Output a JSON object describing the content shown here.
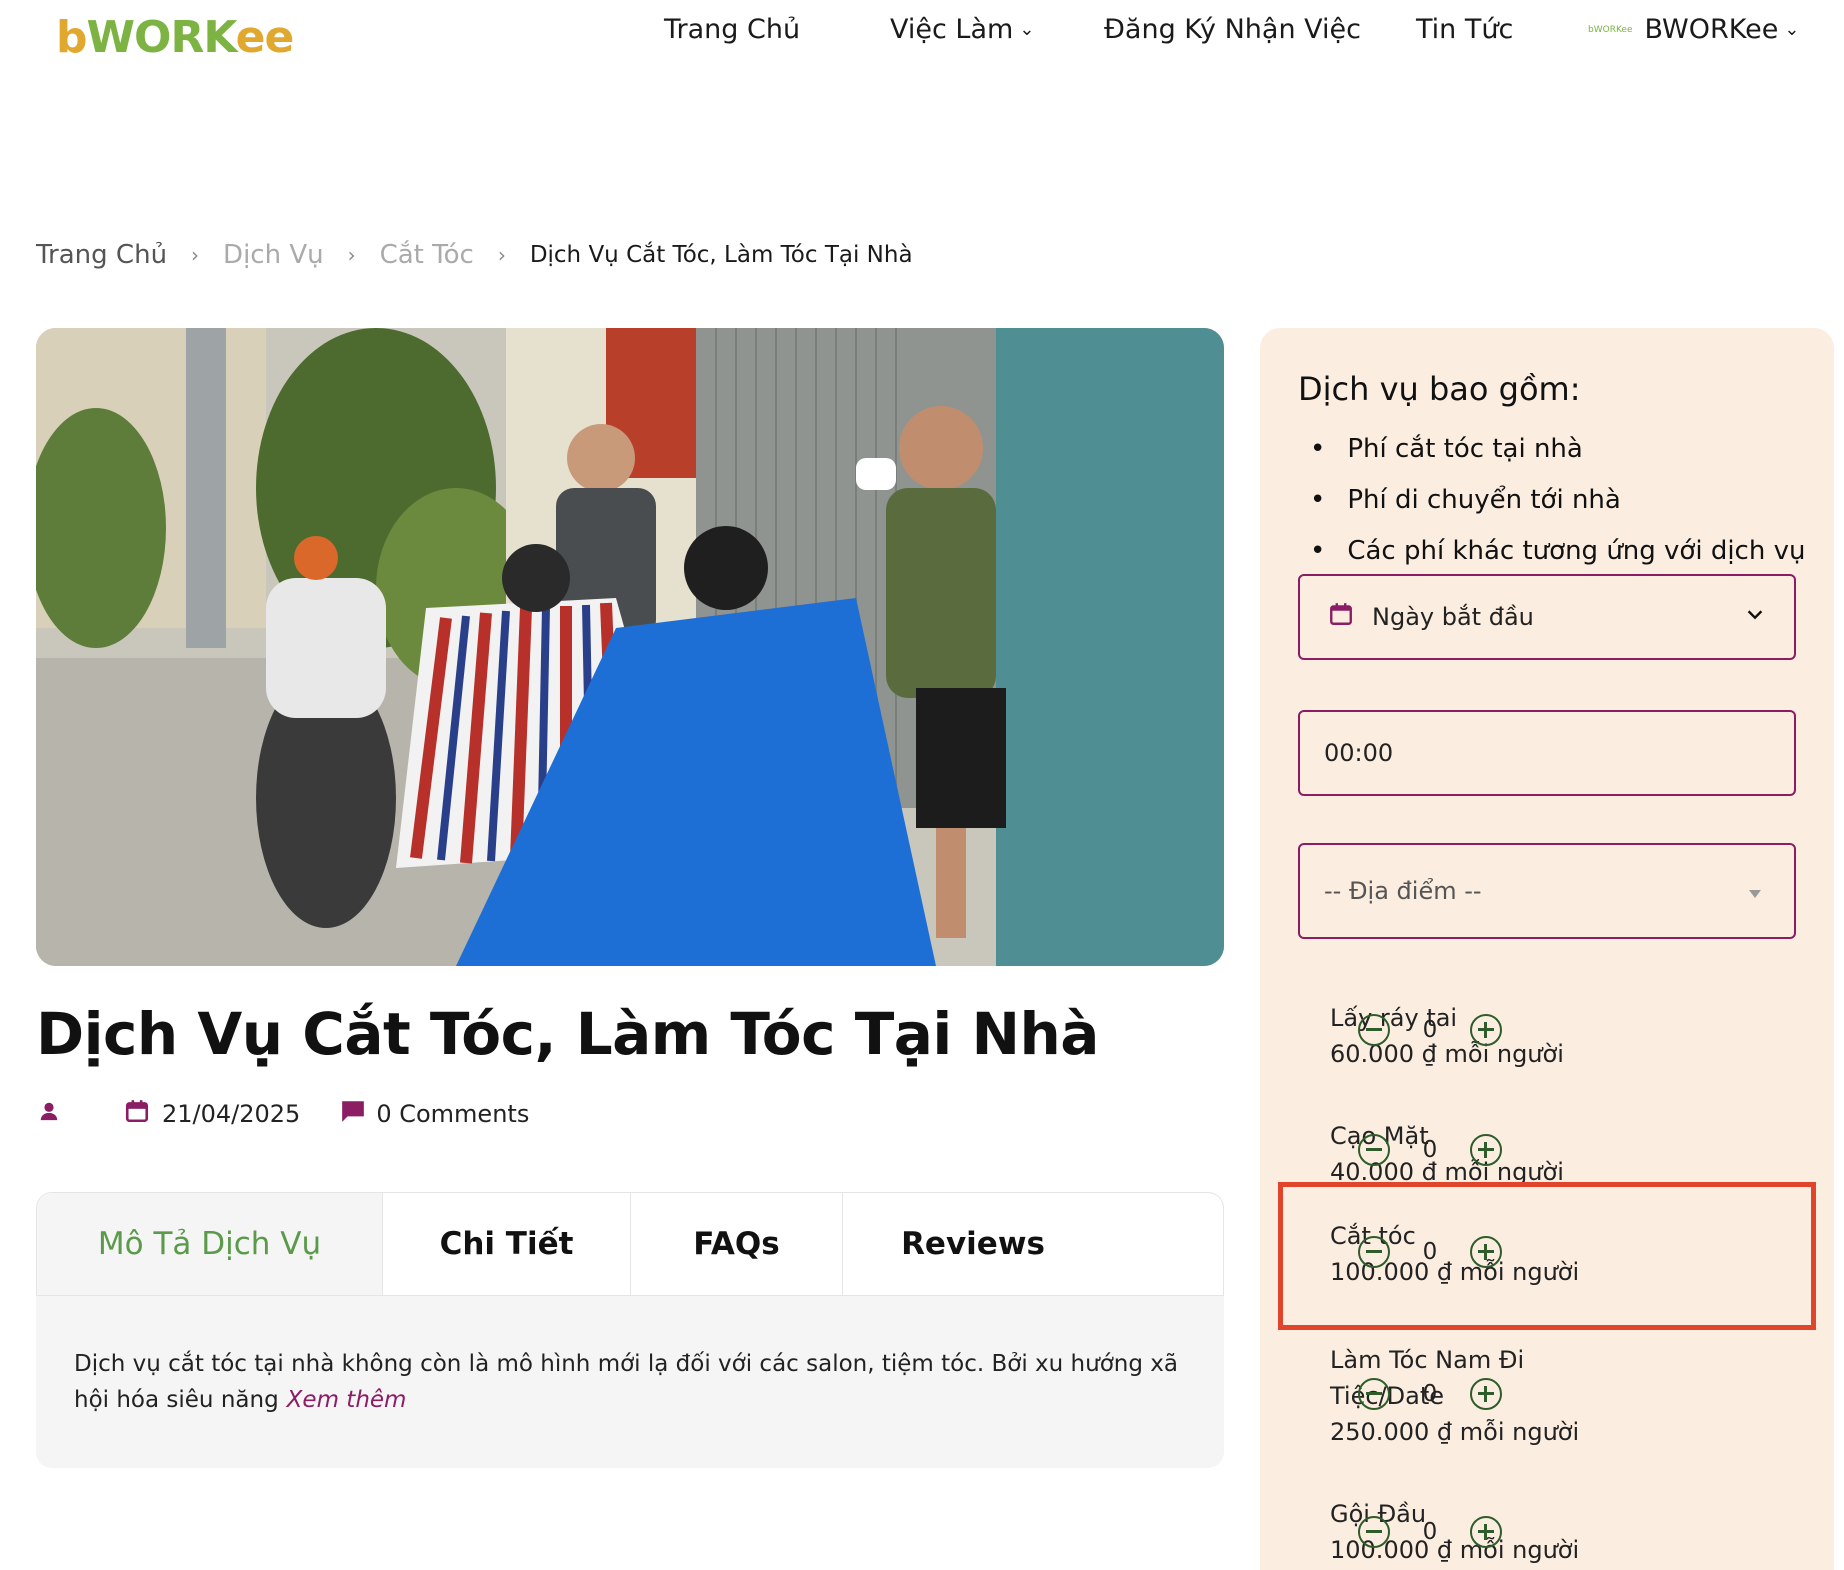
{
  "header": {
    "logo_b": "b",
    "logo_work": "WORK",
    "logo_ee": "ee",
    "nav": {
      "home": "Trang Chủ",
      "jobs": "Việc Làm",
      "register": "Đăng Ký Nhận Việc",
      "news": "Tin Tức",
      "account_logo": "bWORKee",
      "account": "BWORKee"
    }
  },
  "breadcrumb": {
    "home": "Trang Chủ",
    "services": "Dịch Vụ",
    "category": "Cắt Tóc",
    "current": "Dịch Vụ Cắt Tóc, Làm Tóc Tại Nhà"
  },
  "post": {
    "title": "Dịch Vụ Cắt Tóc, Làm Tóc Tại Nhà",
    "date": "21/04/2025",
    "comments": "0 Comments"
  },
  "tabs": {
    "description": "Mô Tả Dịch Vụ",
    "details": "Chi Tiết",
    "faqs": "FAQs",
    "reviews": "Reviews"
  },
  "tab_content": {
    "text": "Dịch vụ cắt tóc tại nhà không còn là mô hình mới lạ đối với các salon, tiệm tóc. Bởi xu hướng xã hội hóa siêu năng",
    "more": "Xem thêm"
  },
  "sidebar": {
    "heading": "Dịch vụ bao gồm:",
    "includes": [
      "Phí cắt tóc tại nhà",
      "Phí di chuyển tới nhà",
      "Các phí khác tương ứng với dịch vụ"
    ],
    "date_label": "Ngày bắt đầu",
    "time_value": "00:00",
    "location_placeholder": "-- Địa điểm --",
    "services": [
      {
        "name": "Lấy ráy tai",
        "price": "60.000 ₫ mỗi người",
        "qty": "0"
      },
      {
        "name": "Cạo Mặt",
        "price": "40.000 ₫ mỗi người",
        "qty": "0"
      },
      {
        "name": "Cắt tóc",
        "price": "100.000 ₫ mỗi người",
        "qty": "0"
      },
      {
        "name": "Làm Tóc Nam Đi Tiệc/Date",
        "price": "250.000 ₫ mỗi người",
        "qty": "0"
      },
      {
        "name": "Gội Đầu",
        "price": "100.000 ₫ mỗi người",
        "qty": "0"
      }
    ]
  },
  "colors": {
    "accent": "#8b1d64",
    "green": "#5a9a4a",
    "sidebar_bg": "#fbeee0",
    "highlight": "#e0442a"
  }
}
